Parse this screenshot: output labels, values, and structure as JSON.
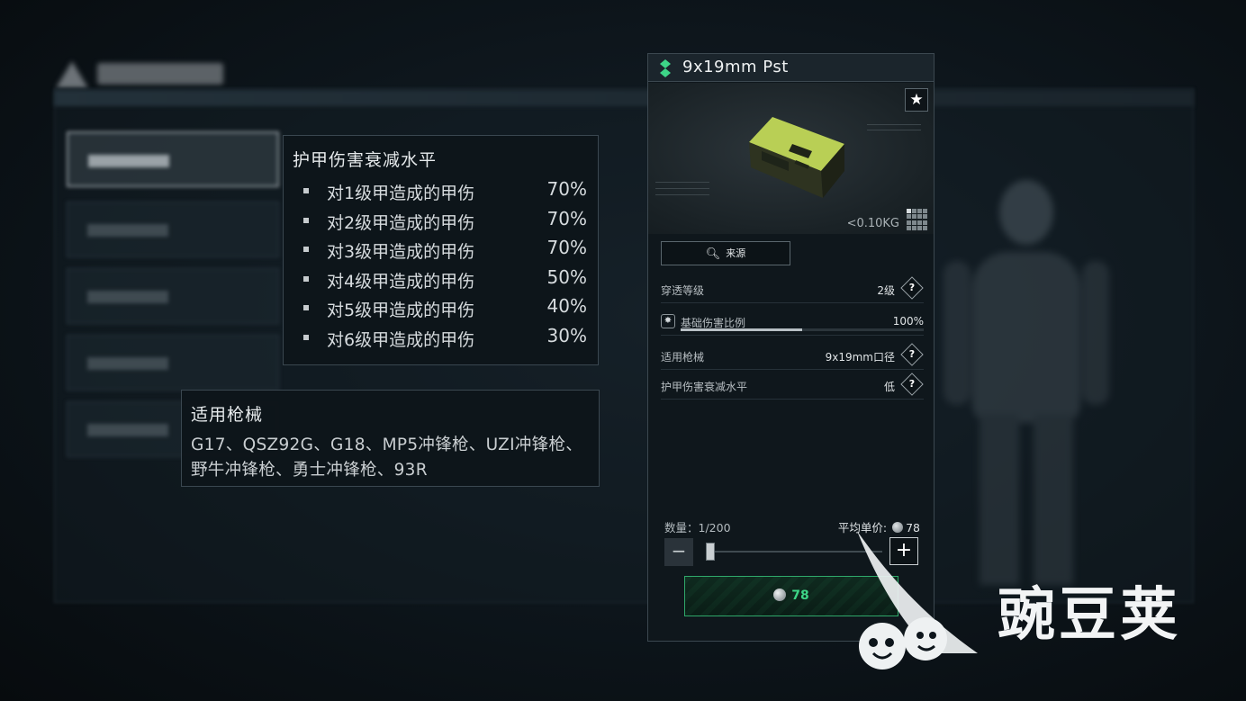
{
  "armor_tooltip": {
    "title": "护甲伤害衰减水平",
    "rows": [
      {
        "label": "对1级甲造成的甲伤",
        "value": "70%"
      },
      {
        "label": "对2级甲造成的甲伤",
        "value": "70%"
      },
      {
        "label": "对3级甲造成的甲伤",
        "value": "70%"
      },
      {
        "label": "对4级甲造成的甲伤",
        "value": "50%"
      },
      {
        "label": "对5级甲造成的甲伤",
        "value": "40%"
      },
      {
        "label": "对6级甲造成的甲伤",
        "value": "30%"
      }
    ]
  },
  "weapon_tooltip": {
    "title": "适用枪械",
    "weapons": "G17、QSZ92G、G18、MP5冲锋枪、UZI冲锋枪、野牛冲锋枪、勇士冲锋枪、93R"
  },
  "item": {
    "name": "9x19mm Pst",
    "rarity_color": "#3dd587",
    "weight": "<0.10KG",
    "source_button": "来源",
    "stats": {
      "penetration": {
        "label": "穿透等级",
        "value": "2级"
      },
      "base_damage": {
        "label": "基础伤害比例",
        "value": "100%",
        "fill": 0.5
      },
      "weapon": {
        "label": "适用枪械",
        "value": "9x19mm口径"
      },
      "armor_decay": {
        "label": "护甲伤害衰减水平",
        "value": "低"
      }
    },
    "help_glyph": "?",
    "quantity_label": "数量：1/200",
    "avg_price_label": "平均单价:",
    "avg_price": "78",
    "buy_price": "78"
  },
  "watermark": {
    "text": "豌豆荚"
  },
  "icons": {
    "star": "star-icon",
    "search": "search-icon",
    "grid": "inventory-grid-icon",
    "coin": "coin-icon",
    "damage": "damage-icon"
  }
}
